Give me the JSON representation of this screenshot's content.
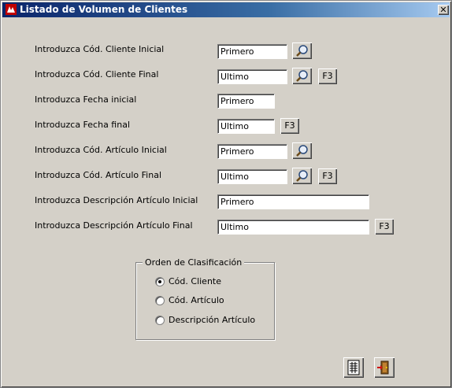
{
  "window": {
    "title": "Listado de Volumen de Clientes",
    "close_glyph": "✕"
  },
  "form": {
    "rows": [
      {
        "label": "Introduzca Cód. Cliente Inicial",
        "value": "Primero"
      },
      {
        "label": "Introduzca Cód. Cliente Final",
        "value": "Ultimo",
        "f3": "F3"
      },
      {
        "label": "Introduzca Fecha inicial",
        "value": "Primero"
      },
      {
        "label": "Introduzca Fecha final",
        "value": "Ultimo",
        "f3": "F3"
      },
      {
        "label": "Introduzca Cód. Artículo Inicial",
        "value": "Primero"
      },
      {
        "label": "Introduzca Cód. Artículo Final",
        "value": "Ultimo",
        "f3": "F3"
      },
      {
        "label": "Introduzca Descripción Artículo Inicial",
        "value": "Primero"
      },
      {
        "label": "Introduzca Descripción Artículo Final",
        "value": "Ultimo",
        "f3": "F3"
      }
    ]
  },
  "sort_order": {
    "title": "Orden de Clasificación",
    "options": [
      {
        "label": "Cód. Cliente",
        "selected": true
      },
      {
        "label": "Cód. Artículo",
        "selected": false
      },
      {
        "label": "Descripción Artículo",
        "selected": false
      }
    ]
  },
  "icons": {
    "search": "magnifier-icon",
    "print": "print-preview-icon",
    "exit": "exit-door-icon"
  }
}
